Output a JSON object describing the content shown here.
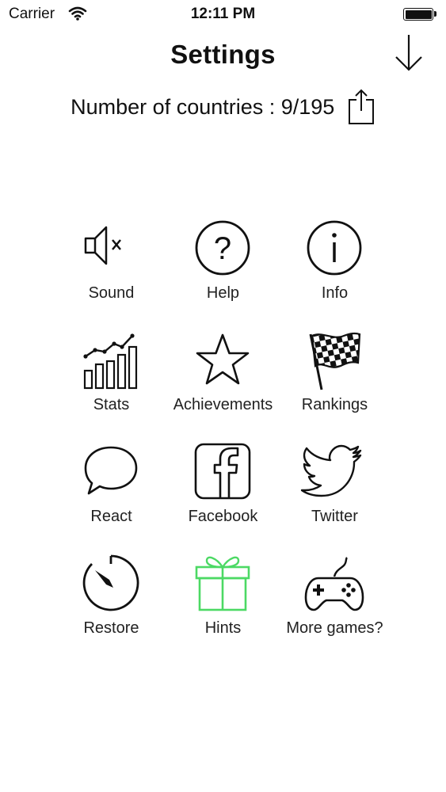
{
  "status_bar": {
    "carrier": "Carrier",
    "time": "12:11 PM"
  },
  "header": {
    "title": "Settings",
    "close_icon": "arrow-down-icon"
  },
  "countries": {
    "label": "Number of countries : 9/195",
    "share_icon": "share-icon"
  },
  "menu": {
    "items": [
      {
        "label": "Sound",
        "icon": "speaker-muted-icon"
      },
      {
        "label": "Help",
        "icon": "question-circle-icon"
      },
      {
        "label": "Info",
        "icon": "info-circle-icon"
      },
      {
        "label": "Stats",
        "icon": "stats-chart-icon"
      },
      {
        "label": "Achievements",
        "icon": "star-icon"
      },
      {
        "label": "Rankings",
        "icon": "checkered-flag-icon"
      },
      {
        "label": "React",
        "icon": "speech-bubble-icon"
      },
      {
        "label": "Facebook",
        "icon": "facebook-icon"
      },
      {
        "label": "Twitter",
        "icon": "twitter-bird-icon"
      },
      {
        "label": "Restore",
        "icon": "timer-icon"
      },
      {
        "label": "Hints",
        "icon": "gift-icon",
        "color": "#4cd964"
      },
      {
        "label": "More games?",
        "icon": "gamepad-icon"
      }
    ]
  }
}
